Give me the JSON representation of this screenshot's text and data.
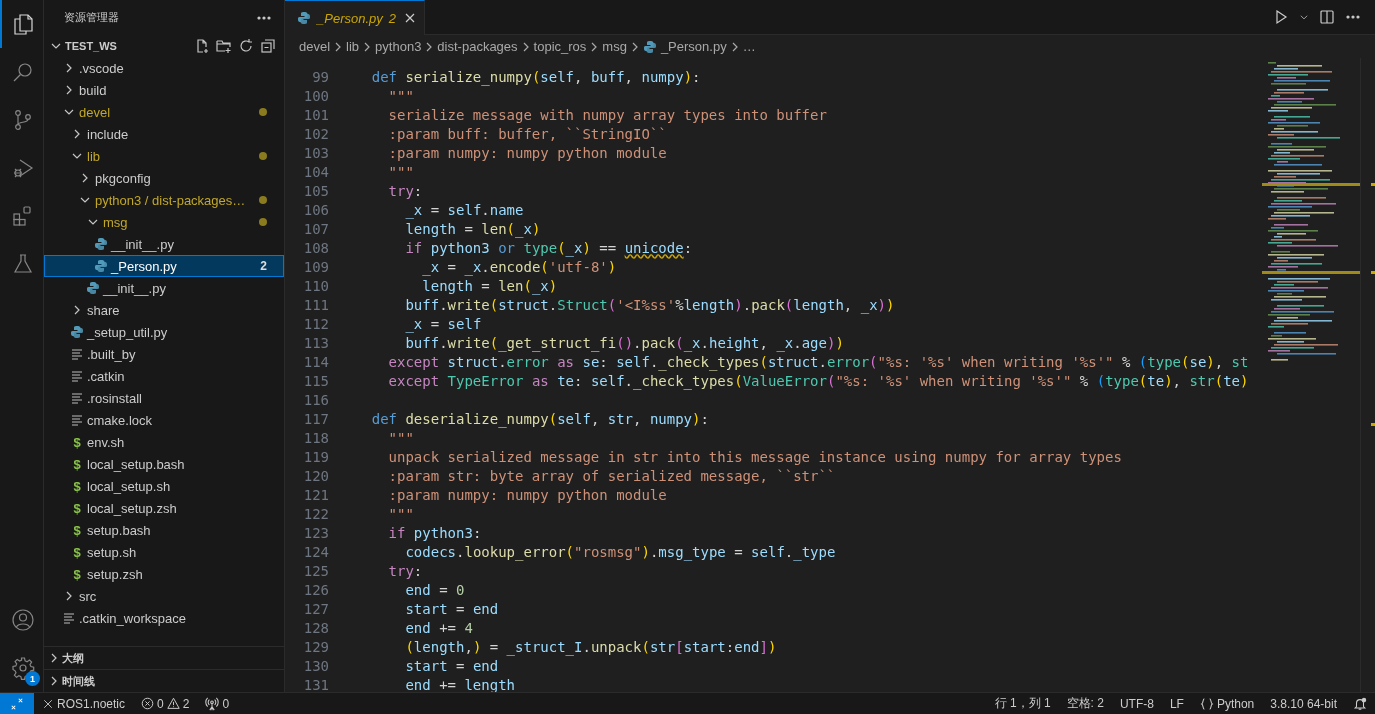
{
  "activity_bar": {
    "items": [
      {
        "kind": "explorer",
        "selected": true
      },
      {
        "kind": "search",
        "selected": false
      },
      {
        "kind": "scm",
        "selected": false
      },
      {
        "kind": "debug",
        "selected": false
      },
      {
        "kind": "extensions",
        "selected": false
      },
      {
        "kind": "testing",
        "selected": false
      }
    ],
    "bottom": [
      {
        "kind": "account"
      },
      {
        "kind": "settings",
        "badge": "1"
      }
    ]
  },
  "sidebar": {
    "title": "资源管理器",
    "workspace": {
      "name": "TEST_WS",
      "expanded": true
    },
    "tree": [
      {
        "label": ".vscode",
        "kind": "folder",
        "expanded": false,
        "modified": false,
        "selected": false
      },
      {
        "label": "build",
        "kind": "folder",
        "expanded": false,
        "modified": false,
        "selected": false
      },
      {
        "label": "devel",
        "kind": "folder",
        "expanded": true,
        "modified": true,
        "selected": false,
        "children": [
          {
            "label": "include",
            "kind": "folder",
            "expanded": false,
            "modified": false,
            "selected": false
          },
          {
            "label": "lib",
            "kind": "folder",
            "expanded": true,
            "modified": true,
            "selected": false,
            "children": [
              {
                "label": "pkgconfig",
                "kind": "folder",
                "expanded": false,
                "modified": false,
                "selected": false
              },
              {
                "label": "python3 / dist-packages…",
                "kind": "folder",
                "expanded": true,
                "modified": true,
                "selected": false,
                "children": [
                  {
                    "label": "msg",
                    "kind": "folder",
                    "expanded": true,
                    "modified": true,
                    "selected": false,
                    "children": [
                      {
                        "label": "__init__.py",
                        "kind": "python",
                        "modified": false,
                        "selected": false
                      },
                      {
                        "label": "_Person.py",
                        "kind": "python",
                        "modified": false,
                        "selected": true,
                        "badge": "2"
                      }
                    ]
                  },
                  {
                    "label": "__init__.py",
                    "kind": "python",
                    "modified": false,
                    "selected": false
                  }
                ]
              }
            ]
          },
          {
            "label": "share",
            "kind": "folder",
            "expanded": false,
            "modified": false,
            "selected": false
          },
          {
            "label": "_setup_util.py",
            "kind": "python",
            "modified": false,
            "selected": false
          },
          {
            "label": ".built_by",
            "kind": "text",
            "modified": false,
            "selected": false
          },
          {
            "label": ".catkin",
            "kind": "text",
            "modified": false,
            "selected": false
          },
          {
            "label": ".rosinstall",
            "kind": "text",
            "modified": false,
            "selected": false
          },
          {
            "label": "cmake.lock",
            "kind": "text",
            "modified": false,
            "selected": false
          },
          {
            "label": "env.sh",
            "kind": "shell",
            "glyph": "$",
            "modified": false,
            "selected": false
          },
          {
            "label": "local_setup.bash",
            "kind": "shell",
            "glyph": "$",
            "modified": false,
            "selected": false
          },
          {
            "label": "local_setup.sh",
            "kind": "shell",
            "glyph": "$",
            "modified": false,
            "selected": false
          },
          {
            "label": "local_setup.zsh",
            "kind": "shell",
            "glyph": "$",
            "modified": false,
            "selected": false
          },
          {
            "label": "setup.bash",
            "kind": "shell",
            "glyph": "$",
            "modified": false,
            "selected": false
          },
          {
            "label": "setup.sh",
            "kind": "shell",
            "glyph": "$",
            "modified": false,
            "selected": false
          },
          {
            "label": "setup.zsh",
            "kind": "shell",
            "glyph": "$",
            "modified": false,
            "selected": false
          }
        ]
      },
      {
        "label": "src",
        "kind": "folder",
        "expanded": false,
        "modified": false,
        "selected": false
      },
      {
        "label": ".catkin_workspace",
        "kind": "text",
        "modified": false,
        "selected": false
      }
    ],
    "sections": [
      {
        "title": "大纲",
        "expanded": false
      },
      {
        "title": "时间线",
        "expanded": false
      }
    ]
  },
  "editor": {
    "tabs": [
      {
        "label": "_Person.py",
        "badge": "2",
        "selected": true,
        "preview": true
      }
    ],
    "breadcrumb": [
      {
        "text": "devel",
        "kind": "folder"
      },
      {
        "text": "lib",
        "kind": "folder"
      },
      {
        "text": "python3",
        "kind": "folder"
      },
      {
        "text": "dist-packages",
        "kind": "folder"
      },
      {
        "text": "topic_ros",
        "kind": "folder"
      },
      {
        "text": "msg",
        "kind": "folder"
      },
      {
        "text": "_Person.py",
        "kind": "python"
      },
      {
        "text": "…",
        "kind": "more"
      }
    ],
    "lines": [
      {
        "number": "99",
        "tokens": [
          {
            "text": "    def ",
            "kind": "kw"
          },
          {
            "text": "serialize_numpy",
            "kind": "fn"
          },
          {
            "text": "(",
            "kind": "b1"
          },
          {
            "text": "self",
            "kind": "var"
          },
          {
            "text": ", ",
            "kind": "t"
          },
          {
            "text": "buff",
            "kind": "var"
          },
          {
            "text": ", ",
            "kind": "t"
          },
          {
            "text": "numpy",
            "kind": "var"
          },
          {
            "text": ")",
            "kind": "b1"
          },
          {
            "text": ":",
            "kind": "t"
          }
        ]
      },
      {
        "number": "100",
        "tokens": [
          {
            "text": "      \"\"\"",
            "kind": "str"
          }
        ]
      },
      {
        "number": "101",
        "tokens": [
          {
            "text": "      serialize message with numpy array types into buffer",
            "kind": "str"
          }
        ]
      },
      {
        "number": "102",
        "tokens": [
          {
            "text": "      :param buff: buffer, ``StringIO``",
            "kind": "str"
          }
        ]
      },
      {
        "number": "103",
        "tokens": [
          {
            "text": "      :param numpy: numpy python module",
            "kind": "str"
          }
        ]
      },
      {
        "number": "104",
        "tokens": [
          {
            "text": "      \"\"\"",
            "kind": "str"
          }
        ]
      },
      {
        "number": "105",
        "tokens": [
          {
            "text": "      try",
            "kind": "ctl"
          },
          {
            "text": ":",
            "kind": "t"
          }
        ]
      },
      {
        "number": "106",
        "tokens": [
          {
            "text": "        _x",
            "kind": "var"
          },
          {
            "text": " = ",
            "kind": "t"
          },
          {
            "text": "self",
            "kind": "var"
          },
          {
            "text": ".",
            "kind": "t"
          },
          {
            "text": "name",
            "kind": "var"
          }
        ]
      },
      {
        "number": "107",
        "tokens": [
          {
            "text": "        length",
            "kind": "var"
          },
          {
            "text": " = ",
            "kind": "t"
          },
          {
            "text": "len",
            "kind": "fn"
          },
          {
            "text": "(",
            "kind": "b1"
          },
          {
            "text": "_x",
            "kind": "var"
          },
          {
            "text": ")",
            "kind": "b1"
          }
        ]
      },
      {
        "number": "108",
        "tokens": [
          {
            "text": "        if ",
            "kind": "ctl"
          },
          {
            "text": "python3 ",
            "kind": "var"
          },
          {
            "text": "or ",
            "kind": "kw"
          },
          {
            "text": "type",
            "kind": "cls"
          },
          {
            "text": "(",
            "kind": "b1"
          },
          {
            "text": "_x",
            "kind": "var"
          },
          {
            "text": ")",
            "kind": "b1"
          },
          {
            "text": " == ",
            "kind": "t"
          },
          {
            "text": "unicode",
            "kind": "warn"
          },
          {
            "text": ":",
            "kind": "t"
          }
        ]
      },
      {
        "number": "109",
        "tokens": [
          {
            "text": "          _x",
            "kind": "var"
          },
          {
            "text": " = ",
            "kind": "t"
          },
          {
            "text": "_x",
            "kind": "var"
          },
          {
            "text": ".",
            "kind": "t"
          },
          {
            "text": "encode",
            "kind": "fn"
          },
          {
            "text": "(",
            "kind": "b1"
          },
          {
            "text": "'utf-8'",
            "kind": "str"
          },
          {
            "text": ")",
            "kind": "b1"
          }
        ]
      },
      {
        "number": "110",
        "tokens": [
          {
            "text": "          length",
            "kind": "var"
          },
          {
            "text": " = ",
            "kind": "t"
          },
          {
            "text": "len",
            "kind": "fn"
          },
          {
            "text": "(",
            "kind": "b1"
          },
          {
            "text": "_x",
            "kind": "var"
          },
          {
            "text": ")",
            "kind": "b1"
          }
        ]
      },
      {
        "number": "111",
        "tokens": [
          {
            "text": "        buff",
            "kind": "var"
          },
          {
            "text": ".",
            "kind": "t"
          },
          {
            "text": "write",
            "kind": "fn"
          },
          {
            "text": "(",
            "kind": "b1"
          },
          {
            "text": "struct",
            "kind": "var"
          },
          {
            "text": ".",
            "kind": "t"
          },
          {
            "text": "Struct",
            "kind": "cls"
          },
          {
            "text": "(",
            "kind": "b2"
          },
          {
            "text": "'<I%ss'",
            "kind": "str"
          },
          {
            "text": "%",
            "kind": "t"
          },
          {
            "text": "length",
            "kind": "var"
          },
          {
            "text": ")",
            "kind": "b2"
          },
          {
            "text": ".",
            "kind": "t"
          },
          {
            "text": "pack",
            "kind": "fn"
          },
          {
            "text": "(",
            "kind": "b2"
          },
          {
            "text": "length",
            "kind": "var"
          },
          {
            "text": ", ",
            "kind": "t"
          },
          {
            "text": "_x",
            "kind": "var"
          },
          {
            "text": ")",
            "kind": "b2"
          },
          {
            "text": ")",
            "kind": "b1"
          }
        ]
      },
      {
        "number": "112",
        "tokens": [
          {
            "text": "        _x",
            "kind": "var"
          },
          {
            "text": " = ",
            "kind": "t"
          },
          {
            "text": "self",
            "kind": "var"
          }
        ]
      },
      {
        "number": "113",
        "tokens": [
          {
            "text": "        buff",
            "kind": "var"
          },
          {
            "text": ".",
            "kind": "t"
          },
          {
            "text": "write",
            "kind": "fn"
          },
          {
            "text": "(",
            "kind": "b1"
          },
          {
            "text": "_get_struct_fi",
            "kind": "fn"
          },
          {
            "text": "()",
            "kind": "b2"
          },
          {
            "text": ".",
            "kind": "t"
          },
          {
            "text": "pack",
            "kind": "fn"
          },
          {
            "text": "(",
            "kind": "b2"
          },
          {
            "text": "_x",
            "kind": "var"
          },
          {
            "text": ".",
            "kind": "t"
          },
          {
            "text": "height",
            "kind": "var"
          },
          {
            "text": ", ",
            "kind": "t"
          },
          {
            "text": "_x",
            "kind": "var"
          },
          {
            "text": ".",
            "kind": "t"
          },
          {
            "text": "age",
            "kind": "var"
          },
          {
            "text": ")",
            "kind": "b2"
          },
          {
            "text": ")",
            "kind": "b1"
          }
        ]
      },
      {
        "number": "114",
        "tokens": [
          {
            "text": "      except ",
            "kind": "ctl"
          },
          {
            "text": "struct",
            "kind": "var"
          },
          {
            "text": ".",
            "kind": "t"
          },
          {
            "text": "error ",
            "kind": "cls"
          },
          {
            "text": "as ",
            "kind": "ctl"
          },
          {
            "text": "se",
            "kind": "var"
          },
          {
            "text": ": ",
            "kind": "t"
          },
          {
            "text": "self",
            "kind": "var"
          },
          {
            "text": ".",
            "kind": "t"
          },
          {
            "text": "_check_types",
            "kind": "fn"
          },
          {
            "text": "(",
            "kind": "b1"
          },
          {
            "text": "struct",
            "kind": "var"
          },
          {
            "text": ".",
            "kind": "t"
          },
          {
            "text": "error",
            "kind": "cls"
          },
          {
            "text": "(",
            "kind": "b2"
          },
          {
            "text": "\"%s: '%s' when writing '%s'\"",
            "kind": "str"
          },
          {
            "text": " % ",
            "kind": "t"
          },
          {
            "text": "(",
            "kind": "b3"
          },
          {
            "text": "type",
            "kind": "cls"
          },
          {
            "text": "(",
            "kind": "b1"
          },
          {
            "text": "se",
            "kind": "var"
          },
          {
            "text": ")",
            "kind": "b1"
          },
          {
            "text": ", ",
            "kind": "t"
          },
          {
            "text": "st",
            "kind": "cls"
          }
        ]
      },
      {
        "number": "115",
        "tokens": [
          {
            "text": "      except ",
            "kind": "ctl"
          },
          {
            "text": "TypeError ",
            "kind": "cls"
          },
          {
            "text": "as ",
            "kind": "ctl"
          },
          {
            "text": "te",
            "kind": "var"
          },
          {
            "text": ": ",
            "kind": "t"
          },
          {
            "text": "self",
            "kind": "var"
          },
          {
            "text": ".",
            "kind": "t"
          },
          {
            "text": "_check_types",
            "kind": "fn"
          },
          {
            "text": "(",
            "kind": "b1"
          },
          {
            "text": "ValueError",
            "kind": "cls"
          },
          {
            "text": "(",
            "kind": "b2"
          },
          {
            "text": "\"%s: '%s' when writing '%s'\"",
            "kind": "str"
          },
          {
            "text": " % ",
            "kind": "t"
          },
          {
            "text": "(",
            "kind": "b3"
          },
          {
            "text": "type",
            "kind": "cls"
          },
          {
            "text": "(",
            "kind": "b1"
          },
          {
            "text": "te",
            "kind": "var"
          },
          {
            "text": ")",
            "kind": "b1"
          },
          {
            "text": ", ",
            "kind": "t"
          },
          {
            "text": "str",
            "kind": "cls"
          },
          {
            "text": "(",
            "kind": "b1"
          },
          {
            "text": "te",
            "kind": "var"
          },
          {
            "text": ")",
            "kind": "b1"
          }
        ]
      },
      {
        "number": "116"
      },
      {
        "number": "117",
        "tokens": [
          {
            "text": "    def ",
            "kind": "kw"
          },
          {
            "text": "deserialize_numpy",
            "kind": "fn"
          },
          {
            "text": "(",
            "kind": "b1"
          },
          {
            "text": "self",
            "kind": "var"
          },
          {
            "text": ", ",
            "kind": "t"
          },
          {
            "text": "str",
            "kind": "var"
          },
          {
            "text": ", ",
            "kind": "t"
          },
          {
            "text": "numpy",
            "kind": "var"
          },
          {
            "text": ")",
            "kind": "b1"
          },
          {
            "text": ":",
            "kind": "t"
          }
        ]
      },
      {
        "number": "118",
        "tokens": [
          {
            "text": "      \"\"\"",
            "kind": "str"
          }
        ]
      },
      {
        "number": "119",
        "tokens": [
          {
            "text": "      unpack serialized message in str into this message instance using numpy for array types",
            "kind": "str"
          }
        ]
      },
      {
        "number": "120",
        "tokens": [
          {
            "text": "      :param str: byte array of serialized message, ``str``",
            "kind": "str"
          }
        ]
      },
      {
        "number": "121",
        "tokens": [
          {
            "text": "      :param numpy: numpy python module",
            "kind": "str"
          }
        ]
      },
      {
        "number": "122",
        "tokens": [
          {
            "text": "      \"\"\"",
            "kind": "str"
          }
        ]
      },
      {
        "number": "123",
        "tokens": [
          {
            "text": "      if ",
            "kind": "ctl"
          },
          {
            "text": "python3",
            "kind": "var"
          },
          {
            "text": ":",
            "kind": "t"
          }
        ]
      },
      {
        "number": "124",
        "tokens": [
          {
            "text": "        codecs",
            "kind": "var"
          },
          {
            "text": ".",
            "kind": "t"
          },
          {
            "text": "lookup_error",
            "kind": "fn"
          },
          {
            "text": "(",
            "kind": "b1"
          },
          {
            "text": "\"rosmsg\"",
            "kind": "str"
          },
          {
            "text": ")",
            "kind": "b1"
          },
          {
            "text": ".",
            "kind": "t"
          },
          {
            "text": "msg_type",
            "kind": "var"
          },
          {
            "text": " = ",
            "kind": "t"
          },
          {
            "text": "self",
            "kind": "var"
          },
          {
            "text": ".",
            "kind": "t"
          },
          {
            "text": "_type",
            "kind": "var"
          }
        ]
      },
      {
        "number": "125",
        "tokens": [
          {
            "text": "      try",
            "kind": "ctl"
          },
          {
            "text": ":",
            "kind": "t"
          }
        ]
      },
      {
        "number": "126",
        "tokens": [
          {
            "text": "        end",
            "kind": "var"
          },
          {
            "text": " = ",
            "kind": "t"
          },
          {
            "text": "0",
            "kind": "num"
          }
        ]
      },
      {
        "number": "127",
        "tokens": [
          {
            "text": "        start",
            "kind": "var"
          },
          {
            "text": " = ",
            "kind": "t"
          },
          {
            "text": "end",
            "kind": "var"
          }
        ]
      },
      {
        "number": "128",
        "tokens": [
          {
            "text": "        end",
            "kind": "var"
          },
          {
            "text": " += ",
            "kind": "t"
          },
          {
            "text": "4",
            "kind": "num"
          }
        ]
      },
      {
        "number": "129",
        "tokens": [
          {
            "text": "        (",
            "kind": "b1"
          },
          {
            "text": "length",
            "kind": "var"
          },
          {
            "text": ",",
            "kind": "t"
          },
          {
            "text": ")",
            "kind": "b1"
          },
          {
            "text": " = ",
            "kind": "t"
          },
          {
            "text": "_struct_I",
            "kind": "var"
          },
          {
            "text": ".",
            "kind": "t"
          },
          {
            "text": "unpack",
            "kind": "fn"
          },
          {
            "text": "(",
            "kind": "b1"
          },
          {
            "text": "str",
            "kind": "var"
          },
          {
            "text": "[",
            "kind": "b2"
          },
          {
            "text": "start",
            "kind": "var"
          },
          {
            "text": ":",
            "kind": "t"
          },
          {
            "text": "end",
            "kind": "var"
          },
          {
            "text": "]",
            "kind": "b2"
          },
          {
            "text": ")",
            "kind": "b1"
          }
        ]
      },
      {
        "number": "130",
        "tokens": [
          {
            "text": "        start",
            "kind": "var"
          },
          {
            "text": " = ",
            "kind": "t"
          },
          {
            "text": "end",
            "kind": "var"
          }
        ]
      },
      {
        "number": "131",
        "tokens": [
          {
            "text": "        end",
            "kind": "var"
          },
          {
            "text": " += ",
            "kind": "t"
          },
          {
            "text": "length",
            "kind": "var"
          }
        ]
      }
    ]
  },
  "status_bar": {
    "left": [
      {
        "kind": "workspace",
        "text": "ROS1.noetic"
      },
      {
        "kind": "problems",
        "errors": "0",
        "warnings": "2"
      },
      {
        "kind": "ports",
        "text": "0"
      }
    ],
    "right": [
      {
        "kind": "text",
        "text": "行 1，列 1"
      },
      {
        "kind": "text",
        "text": "空格: 2"
      },
      {
        "kind": "text",
        "text": "UTF-8"
      },
      {
        "kind": "text",
        "text": "LF"
      },
      {
        "kind": "language",
        "text": "Python"
      },
      {
        "kind": "text",
        "text": "3.8.10 64-bit"
      },
      {
        "kind": "bell"
      }
    ]
  }
}
